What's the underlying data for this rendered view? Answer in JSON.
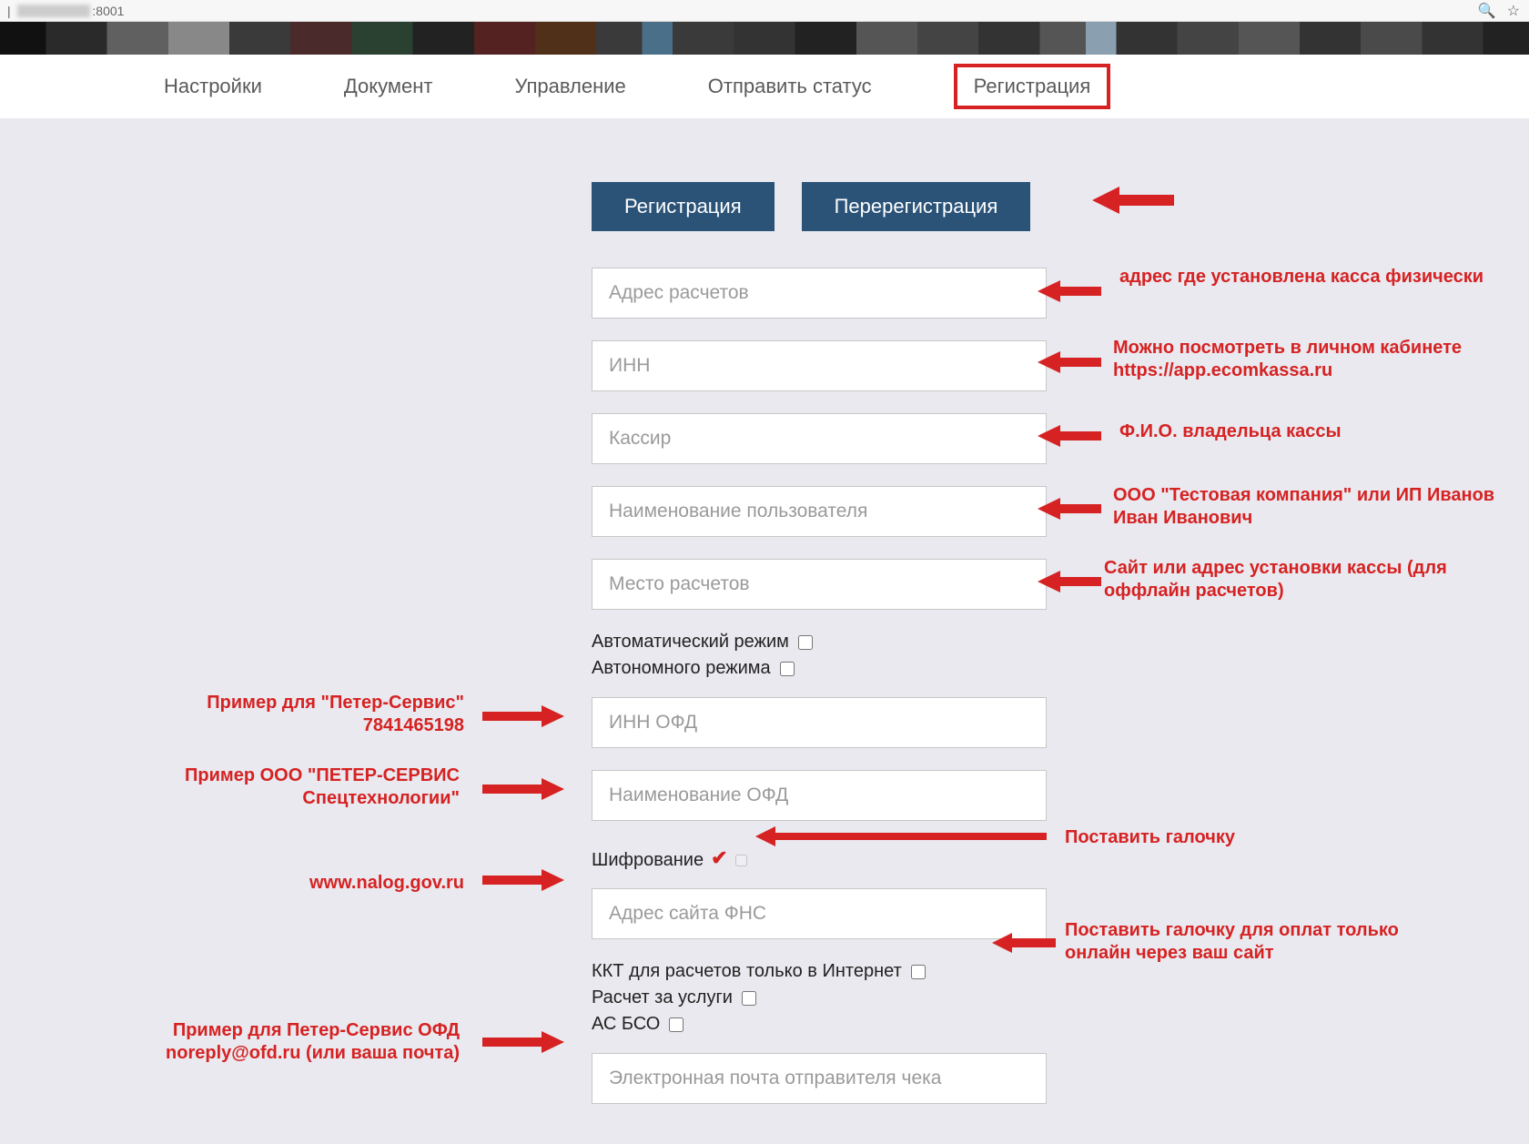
{
  "browser": {
    "url_suffix": ":8001"
  },
  "nav": {
    "items": [
      "Настройки",
      "Документ",
      "Управление",
      "Отправить статус",
      "Регистрация"
    ],
    "active_index": 4
  },
  "buttons": {
    "register": "Регистрация",
    "reregister": "Перерегистрация"
  },
  "form": {
    "address": {
      "placeholder": "Адрес расчетов"
    },
    "inn": {
      "placeholder": "ИНН"
    },
    "cashier": {
      "placeholder": "Кассир"
    },
    "username": {
      "placeholder": "Наименование пользователя"
    },
    "payplace": {
      "placeholder": "Место расчетов"
    },
    "auto_mode_label": "Автоматический режим",
    "autonomous_label": "Автономного режима",
    "ofd_inn": {
      "placeholder": "ИНН ОФД"
    },
    "ofd_name": {
      "placeholder": "Наименование ОФД"
    },
    "encryption_label": "Шифрование",
    "fns_site": {
      "placeholder": "Адрес сайта ФНС"
    },
    "kkt_internet_label": "ККТ для расчетов только в Интернет",
    "services_label": "Расчет за услуги",
    "as_bso_label": "АС БСО",
    "email": {
      "placeholder": "Электронная почта отправителя чека"
    }
  },
  "annotations": {
    "addr_right": "адрес где установлена касса физически",
    "inn_right": "Можно посмотреть в личном кабинете https://app.ecomkassa.ru",
    "cashier_right": "Ф.И.О. владельца кассы",
    "username_right": "ООО \"Тестовая компания\" или ИП Иванов Иван Иванович",
    "payplace_right": "Сайт или адрес установки кассы (для оффлайн расчетов)",
    "ofd_inn_left": "Пример для \"Петер-Сервис\" 7841465198",
    "ofd_name_left": "Пример ООО \"ПЕТЕР-СЕРВИС Спецтехнологии\"",
    "encryption_right": "Поставить галочку",
    "fns_left": "www.nalog.gov.ru",
    "kkt_right": "Поставить галочку для оплат только онлайн через ваш сайт",
    "email_left": "Пример для Петер-Сервис ОФД noreply@ofd.ru (или ваша почта)"
  }
}
